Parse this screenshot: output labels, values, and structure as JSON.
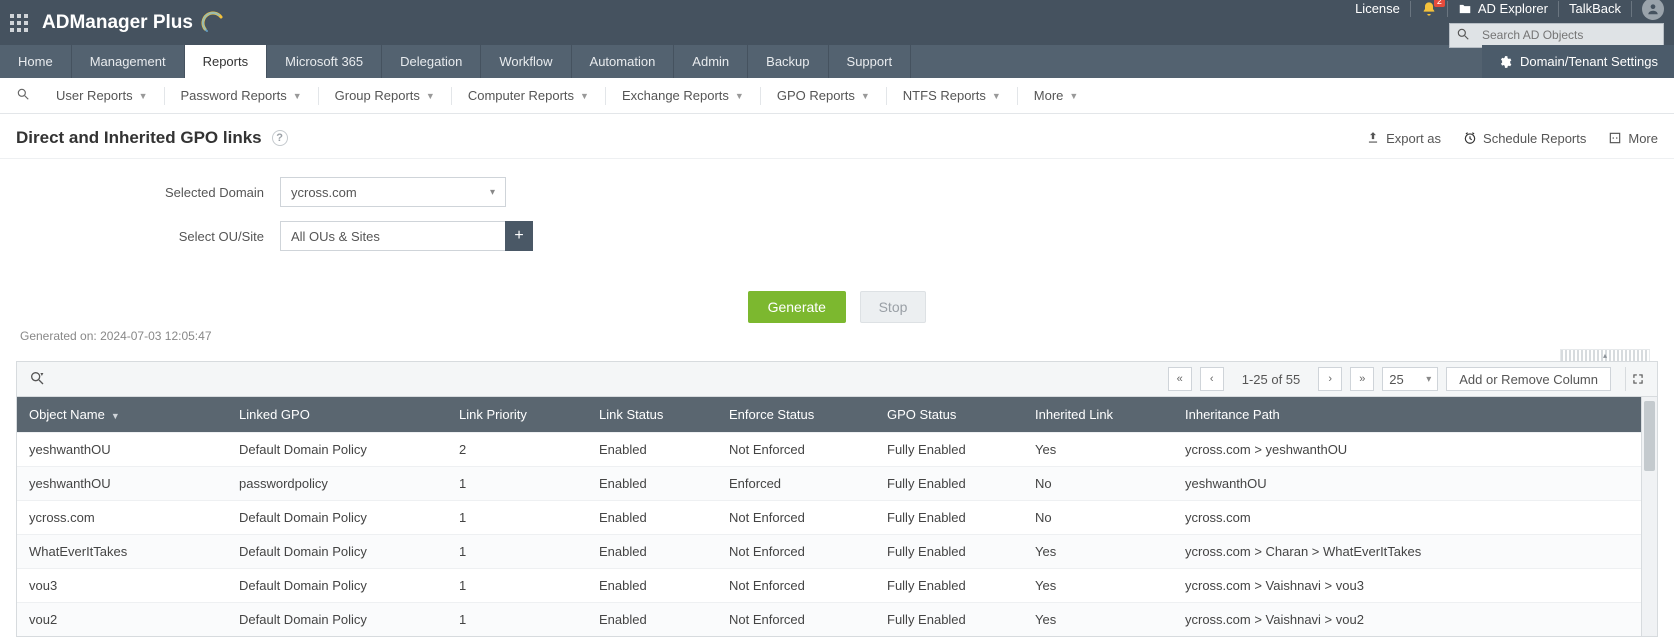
{
  "brand": "ADManager Plus",
  "top_links": {
    "license": "License",
    "notif_count": "2",
    "explorer": "AD Explorer",
    "talkback": "TalkBack"
  },
  "search_placeholder": "Search AD Objects",
  "mainnav": [
    "Home",
    "Management",
    "Reports",
    "Microsoft 365",
    "Delegation",
    "Workflow",
    "Automation",
    "Admin",
    "Backup",
    "Support"
  ],
  "mainnav_active": 2,
  "settings_btn": "Domain/Tenant Settings",
  "subnav": [
    "User Reports",
    "Password Reports",
    "Group Reports",
    "Computer Reports",
    "Exchange Reports",
    "GPO Reports",
    "NTFS Reports",
    "More"
  ],
  "page_title": "Direct and Inherited GPO links",
  "page_actions": {
    "export": "Export as",
    "schedule": "Schedule Reports",
    "more": "More"
  },
  "form": {
    "domain_label": "Selected Domain",
    "domain_value": "ycross.com",
    "ou_label": "Select OU/Site",
    "ou_value": "All OUs & Sites"
  },
  "buttons": {
    "generate": "Generate",
    "stop": "Stop"
  },
  "generated_on_label": "Generated on: ",
  "generated_on_value": "2024-07-03 12:05:47",
  "pager": {
    "range": "1-25 of 55",
    "size": "25"
  },
  "col_btn": "Add or Remove Column",
  "columns": [
    "Object Name",
    "Linked GPO",
    "Link Priority",
    "Link Status",
    "Enforce Status",
    "GPO Status",
    "Inherited Link",
    "Inheritance Path"
  ],
  "rows": [
    {
      "c": [
        "yeshwanthOU",
        "Default Domain Policy",
        "2",
        "Enabled",
        "Not Enforced",
        "Fully Enabled",
        "Yes",
        "ycross.com > yeshwanthOU"
      ]
    },
    {
      "c": [
        "yeshwanthOU",
        "passwordpolicy",
        "1",
        "Enabled",
        "Enforced",
        "Fully Enabled",
        "No",
        "yeshwanthOU"
      ]
    },
    {
      "c": [
        "ycross.com",
        "Default Domain Policy",
        "1",
        "Enabled",
        "Not Enforced",
        "Fully Enabled",
        "No",
        "ycross.com"
      ]
    },
    {
      "c": [
        "WhatEverItTakes",
        "Default Domain Policy",
        "1",
        "Enabled",
        "Not Enforced",
        "Fully Enabled",
        "Yes",
        "ycross.com > Charan > WhatEverItTakes"
      ]
    },
    {
      "c": [
        "vou3",
        "Default Domain Policy",
        "1",
        "Enabled",
        "Not Enforced",
        "Fully Enabled",
        "Yes",
        "ycross.com > Vaishnavi > vou3"
      ]
    },
    {
      "c": [
        "vou2",
        "Default Domain Policy",
        "1",
        "Enabled",
        "Not Enforced",
        "Fully Enabled",
        "Yes",
        "ycross.com > Vaishnavi > vou2"
      ]
    }
  ]
}
